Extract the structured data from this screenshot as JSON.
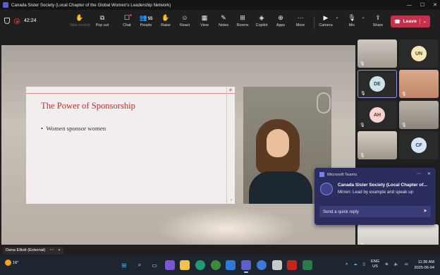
{
  "window": {
    "title": "Canada Sister Society (Local Chapter of the Global Women's Leadership Network)"
  },
  "toolbar": {
    "timer": "42:24",
    "items": [
      {
        "label": "Take control",
        "icon": "take-control-icon"
      },
      {
        "label": "Pop out",
        "icon": "pop-out-icon"
      },
      {
        "label": "Chat",
        "icon": "chat-icon"
      },
      {
        "label": "People",
        "icon": "people-icon",
        "count": "55"
      },
      {
        "label": "Raise",
        "icon": "raise-hand-icon"
      },
      {
        "label": "React",
        "icon": "react-icon"
      },
      {
        "label": "View",
        "icon": "view-icon"
      },
      {
        "label": "Notes",
        "icon": "notes-icon"
      },
      {
        "label": "Rooms",
        "icon": "rooms-icon"
      },
      {
        "label": "Copilot",
        "icon": "copilot-icon"
      },
      {
        "label": "Apps",
        "icon": "apps-icon"
      },
      {
        "label": "More",
        "icon": "more-icon"
      },
      {
        "label": "Camera",
        "icon": "camera-icon"
      },
      {
        "label": "Mic",
        "icon": "mic-icon"
      },
      {
        "label": "Share",
        "icon": "share-icon"
      }
    ],
    "leave_label": "Leave"
  },
  "slide": {
    "title": "The Power of Sponsorship",
    "bullet": "Women sponsor women"
  },
  "participants": [
    {
      "initials": "",
      "color": "#5a5a5a"
    },
    {
      "initials": "UN",
      "color": "#f4e6b8",
      "text_color": "#5a4a1a"
    },
    {
      "initials": "DE",
      "color": "#cfe3e8",
      "text_color": "#2d4a52"
    },
    {
      "initials": "",
      "color": "#5a5a5a"
    },
    {
      "initials": "AH",
      "color": "#f6d4d1",
      "text_color": "#6d2a24"
    },
    {
      "initials": "",
      "color": "#5a5a5a"
    },
    {
      "initials": "",
      "color": "#5a5a5a"
    },
    {
      "initials": "CF",
      "color": "#d7e4f5",
      "text_color": "#223a5a"
    }
  ],
  "bottom": {
    "name_tag": "Dana Elliott (External)"
  },
  "toast": {
    "app": "Microsoft Teams",
    "title": "Canada Sister Society (Local Chapter of...",
    "message": "Mirren: Lead by example and speak up",
    "reply_placeholder": "Send a quick reply"
  },
  "taskbar": {
    "temp": "16°",
    "lang": "ENG",
    "region": "US",
    "time": "11:36 AM",
    "date": "2025-06-04"
  }
}
